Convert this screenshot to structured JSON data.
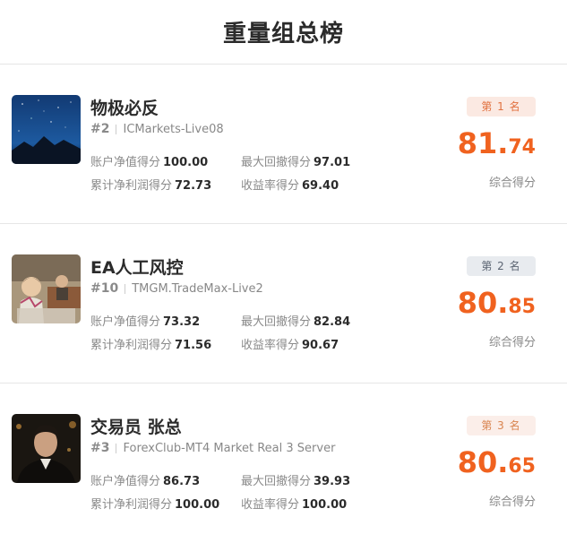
{
  "page": {
    "title": "重量组总榜"
  },
  "entries": [
    {
      "name": "物极必反",
      "index": "#2",
      "account": "ICMarkets-Live08",
      "rank_label": "第 1 名",
      "score_int": "81.",
      "score_dec": "74",
      "score_label": "综合得分",
      "metrics": [
        {
          "label": "账户净值得分",
          "value": "100.00"
        },
        {
          "label": "最大回撤得分",
          "value": "97.01"
        },
        {
          "label": "累计净利润得分",
          "value": "72.73"
        },
        {
          "label": "收益率得分",
          "value": "69.40"
        }
      ]
    },
    {
      "name": "EA人工风控",
      "index": "#10",
      "account": "TMGM.TradeMax-Live2",
      "rank_label": "第 2 名",
      "score_int": "80.",
      "score_dec": "85",
      "score_label": "综合得分",
      "metrics": [
        {
          "label": "账户净值得分",
          "value": "73.32"
        },
        {
          "label": "最大回撤得分",
          "value": "82.84"
        },
        {
          "label": "累计净利润得分",
          "value": "71.56"
        },
        {
          "label": "收益率得分",
          "value": "90.67"
        }
      ]
    },
    {
      "name": "交易员 张总",
      "index": "#3",
      "account": "ForexClub-MT4 Market Real 3 Server",
      "rank_label": "第 3 名",
      "score_int": "80.",
      "score_dec": "65",
      "score_label": "综合得分",
      "metrics": [
        {
          "label": "账户净值得分",
          "value": "86.73"
        },
        {
          "label": "最大回撤得分",
          "value": "39.93"
        },
        {
          "label": "累计净利润得分",
          "value": "100.00"
        },
        {
          "label": "收益率得分",
          "value": "100.00"
        }
      ]
    }
  ],
  "colors": {
    "score": "#f0621f",
    "rank1_bg": "#fbe9e2",
    "rank2_bg": "#e8ebef",
    "rank3_bg": "#fbeee9"
  },
  "icons": [
    "night-sky-avatar-icon",
    "child-photo-avatar-icon",
    "man-portrait-avatar-icon"
  ]
}
